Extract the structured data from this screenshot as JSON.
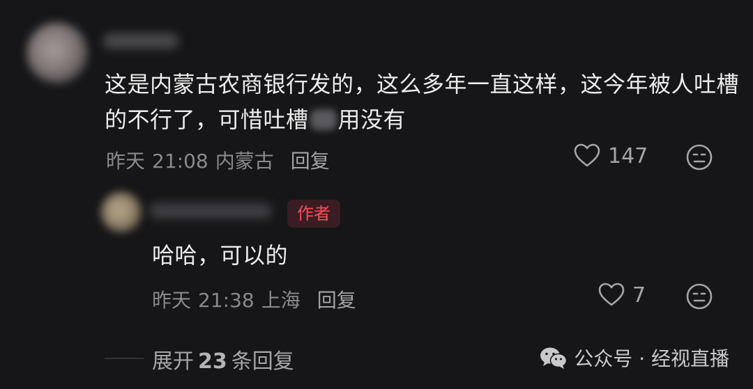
{
  "comment": {
    "text_part1": "这是内蒙古农商银行发的，这么多年一直这样，这今年被人吐槽的不行了，可惜吐槽",
    "text_part2": "用没有",
    "date": "昨天",
    "time": "21:08",
    "location": "内蒙古",
    "reply_label": "回复",
    "likes": "147"
  },
  "reply": {
    "author_badge": "作者",
    "text": "哈哈，可以的",
    "date": "昨天",
    "time": "21:38",
    "location": "上海",
    "reply_label": "回复",
    "likes": "7"
  },
  "expand": {
    "prefix": "展开",
    "count": "23",
    "suffix": "条回复"
  },
  "watermark": {
    "text": "公众号 · 经视直播",
    "icon": "wechat-icon"
  },
  "colors": {
    "background": "#161618",
    "author_badge": "#ff4b5c",
    "meta_text": "#8a8a8e"
  }
}
